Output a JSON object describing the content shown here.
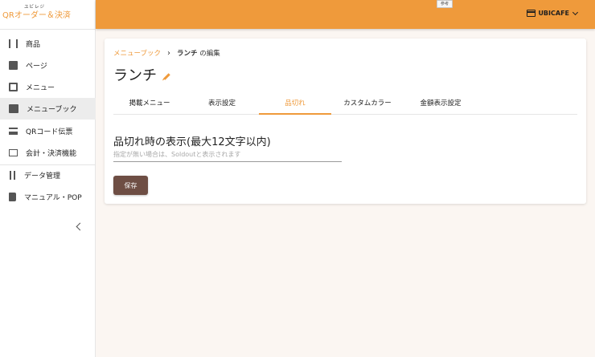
{
  "brand": {
    "small": "ユビレジ",
    "main": "QRオーダー＆決済",
    "accent": "#ef9a3b"
  },
  "header": {
    "ref_chip": "参考",
    "store_name": "UBICAFE",
    "store_icon": "store-icon"
  },
  "sidebar": {
    "items": [
      {
        "label": "商品",
        "icon": "restaurant-icon"
      },
      {
        "label": "ページ",
        "icon": "document-icon"
      },
      {
        "label": "メニュー",
        "icon": "menu-list-icon"
      },
      {
        "label": "メニューブック",
        "icon": "menu-book-icon",
        "active": true
      },
      {
        "label": "QRコード伝票",
        "icon": "receipt-icon"
      },
      {
        "label": "会計・決済機能",
        "icon": "payment-icon"
      },
      {
        "label": "データ管理",
        "icon": "swap-vert-icon"
      },
      {
        "label": "マニュアル・POP",
        "icon": "manual-icon"
      }
    ]
  },
  "breadcrumb": {
    "parent": "メニューブック",
    "current_bold": "ランチ",
    "current_suffix": "の編集"
  },
  "page": {
    "title": "ランチ"
  },
  "tabs": [
    "掲載メニュー",
    "表示設定",
    "品切れ",
    "カスタムカラー",
    "金額表示設定"
  ],
  "active_tab": "品切れ",
  "soldout": {
    "section_title": "品切れ時の表示(最大12文字以内)",
    "input_placeholder": "指定が無い場合は、Soldoutと表示されます",
    "input_value": "",
    "save_label": "保存"
  }
}
